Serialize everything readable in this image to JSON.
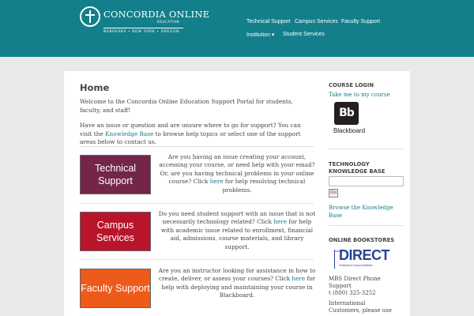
{
  "header": {
    "logo_title": "CONCORDIA ONLINE",
    "logo_sub": "EDUCATION",
    "logo_states": "NEBRASKA • NEW YORK • OREGON",
    "brand_color": "#127f8b"
  },
  "nav": {
    "items": [
      "Technical Support",
      "Campus Services",
      "Faculty Support",
      "Institution ▾",
      "Student Services"
    ]
  },
  "main": {
    "title": "Home",
    "intro_1": "Welcome to the Concordia Online Education  Support Portal for students, faculty, and staff!",
    "intro_2a": "Have an issue or question and are unsure where to go for support? You can visit the ",
    "intro_2_link": "Knowledge Base",
    "intro_2b": " to browse help topics or select one of the support areas below to contact us.",
    "sections": [
      {
        "button": "Technical Support",
        "text_a": "Are you having an issue creating your account, accessing your course, or need help with your email? Or, are you having technical problems in your online course? Click ",
        "link": "here",
        "text_b": " for help resolving technical problems."
      },
      {
        "button": "Campus Services",
        "text_a": "Do you need student support with an issue that is not necessarily technology related? Click ",
        "link": "here",
        "text_b": " for help with academic issue related to enrollment, financial aid, admissions, course materials, and library support."
      },
      {
        "button": "Faculty Support",
        "text_a": "Are you an instructor looking for assistance in how to create, deliver, or assess your courses? Click ",
        "link": "here",
        "text_b": " for help with deploying and maintaining your course in Blackboard."
      }
    ]
  },
  "sidebar": {
    "course_login_title": "COURSE LOGIN",
    "course_login_link": "Take me to my course",
    "blackboard_mark": "Bb",
    "blackboard_label": "Blackboard",
    "kb_title": "TECHNOLOGY KNOWLEDGE BASE",
    "kb_search_value": "",
    "go_label": "Go",
    "kb_link": "Browse the Knowledge Base",
    "bookstores_title": "ONLINE BOOKSTORES",
    "mbs_big": "DIRECT",
    "mbs_side": "MBS",
    "mbs_tag": "Textbooks & Course Materials",
    "mbs_name": "MBS Direct Phone Support",
    "mbs_phone": "t (800) 325-3252",
    "intl_text": "International Customers, please use"
  }
}
